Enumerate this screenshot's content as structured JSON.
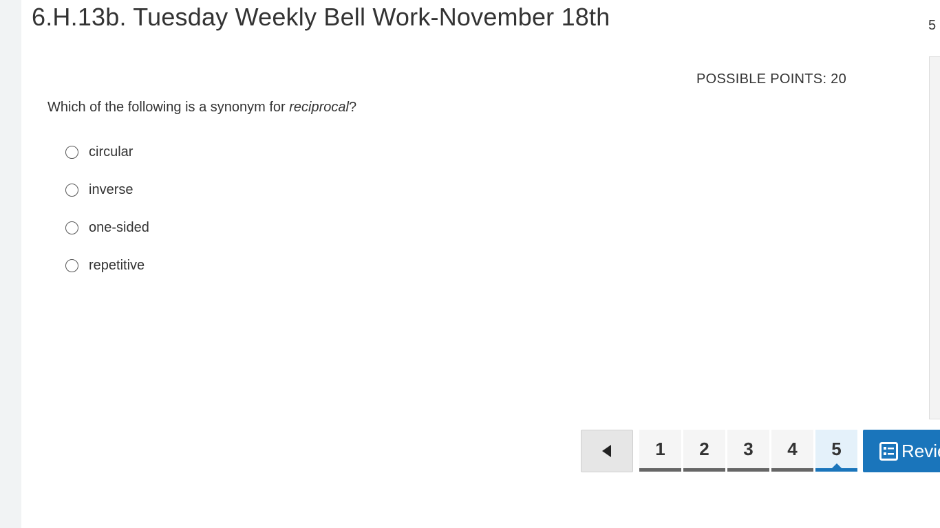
{
  "page": {
    "title": "6.H.13b. Tuesday Weekly Bell Work-November 18th",
    "corner_count": "5"
  },
  "question": {
    "possible_points": "POSSIBLE POINTS: 20",
    "prompt_before": "Which of the following is a synonym for ",
    "prompt_emphasis": "reciprocal",
    "prompt_after": "?",
    "options": [
      {
        "label": "circular",
        "selected": false
      },
      {
        "label": "inverse",
        "selected": false
      },
      {
        "label": "one-sided",
        "selected": false
      },
      {
        "label": "repetitive",
        "selected": false
      }
    ]
  },
  "pager": {
    "prev_icon": "triangle-left-icon",
    "pages": [
      "1",
      "2",
      "3",
      "4",
      "5"
    ],
    "active_page": "5",
    "review_label": "Review",
    "review_icon": "review-list-icon"
  },
  "colors": {
    "accent": "#1a75bb",
    "active_page_bg": "#e4f1fa",
    "page_underline": "#666666"
  }
}
